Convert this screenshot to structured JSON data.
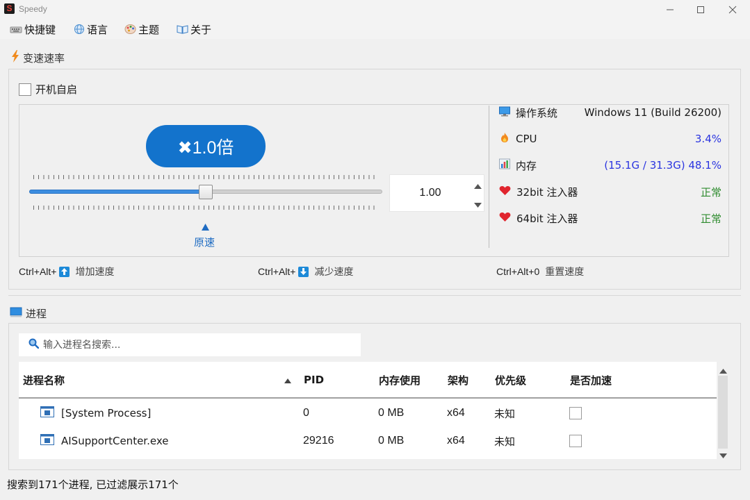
{
  "window": {
    "title": "Speedy",
    "logo_letter": "S"
  },
  "menu": [
    {
      "label": "快捷键",
      "icon": "keyboard-icon"
    },
    {
      "label": "语言",
      "icon": "globe-icon"
    },
    {
      "label": "主题",
      "icon": "palette-icon"
    },
    {
      "label": "关于",
      "icon": "book-icon"
    }
  ],
  "speed_section": {
    "title": "变速速率",
    "autostart_label": "开机自启",
    "autostart_checked": false,
    "multiplier_label": "✖1.0倍",
    "slider_value": 1.0,
    "spin_value": "1.00",
    "original_speed_label": "原速",
    "accent": "#1373cc"
  },
  "system_info": [
    {
      "label": "操作系统",
      "value": "Windows 11 (Build 26200)",
      "icon": "monitor-icon",
      "color": "#1a1a1a"
    },
    {
      "label": "CPU",
      "value": "3.4%",
      "icon": "flame-icon",
      "color": "#2b35e0"
    },
    {
      "label": "内存",
      "value": "(15.1G / 31.3G) 48.1%",
      "icon": "bar-chart-icon",
      "color": "#2b35e0"
    },
    {
      "label": "32bit 注入器",
      "value": "正常",
      "icon": "heart-icon",
      "color": "#2e8b2e"
    },
    {
      "label": "64bit 注入器",
      "value": "正常",
      "icon": "heart-icon",
      "color": "#2e8b2e"
    }
  ],
  "hotkeys": [
    {
      "keys": "Ctrl+Alt+",
      "icon": "arrow-up-icon",
      "desc": "增加速度"
    },
    {
      "keys": "Ctrl+Alt+",
      "icon": "arrow-down-icon",
      "desc": "减少速度"
    },
    {
      "keys": "Ctrl+Alt+0",
      "icon": "",
      "desc": "重置速度"
    }
  ],
  "process_section": {
    "title": "进程",
    "search_placeholder": "输入进程名搜索...",
    "columns": [
      "进程名称",
      "PID",
      "内存使用",
      "架构",
      "优先级",
      "是否加速"
    ],
    "rows": [
      {
        "name": "[System Process]",
        "pid": "0",
        "memory": "0 MB",
        "arch": "x64",
        "priority": "未知",
        "accelerated": false
      },
      {
        "name": "AISupportCenter.exe",
        "pid": "29216",
        "memory": "0 MB",
        "arch": "x64",
        "priority": "未知",
        "accelerated": false
      }
    ]
  },
  "status_text": "搜索到171个进程, 已过滤展示171个"
}
